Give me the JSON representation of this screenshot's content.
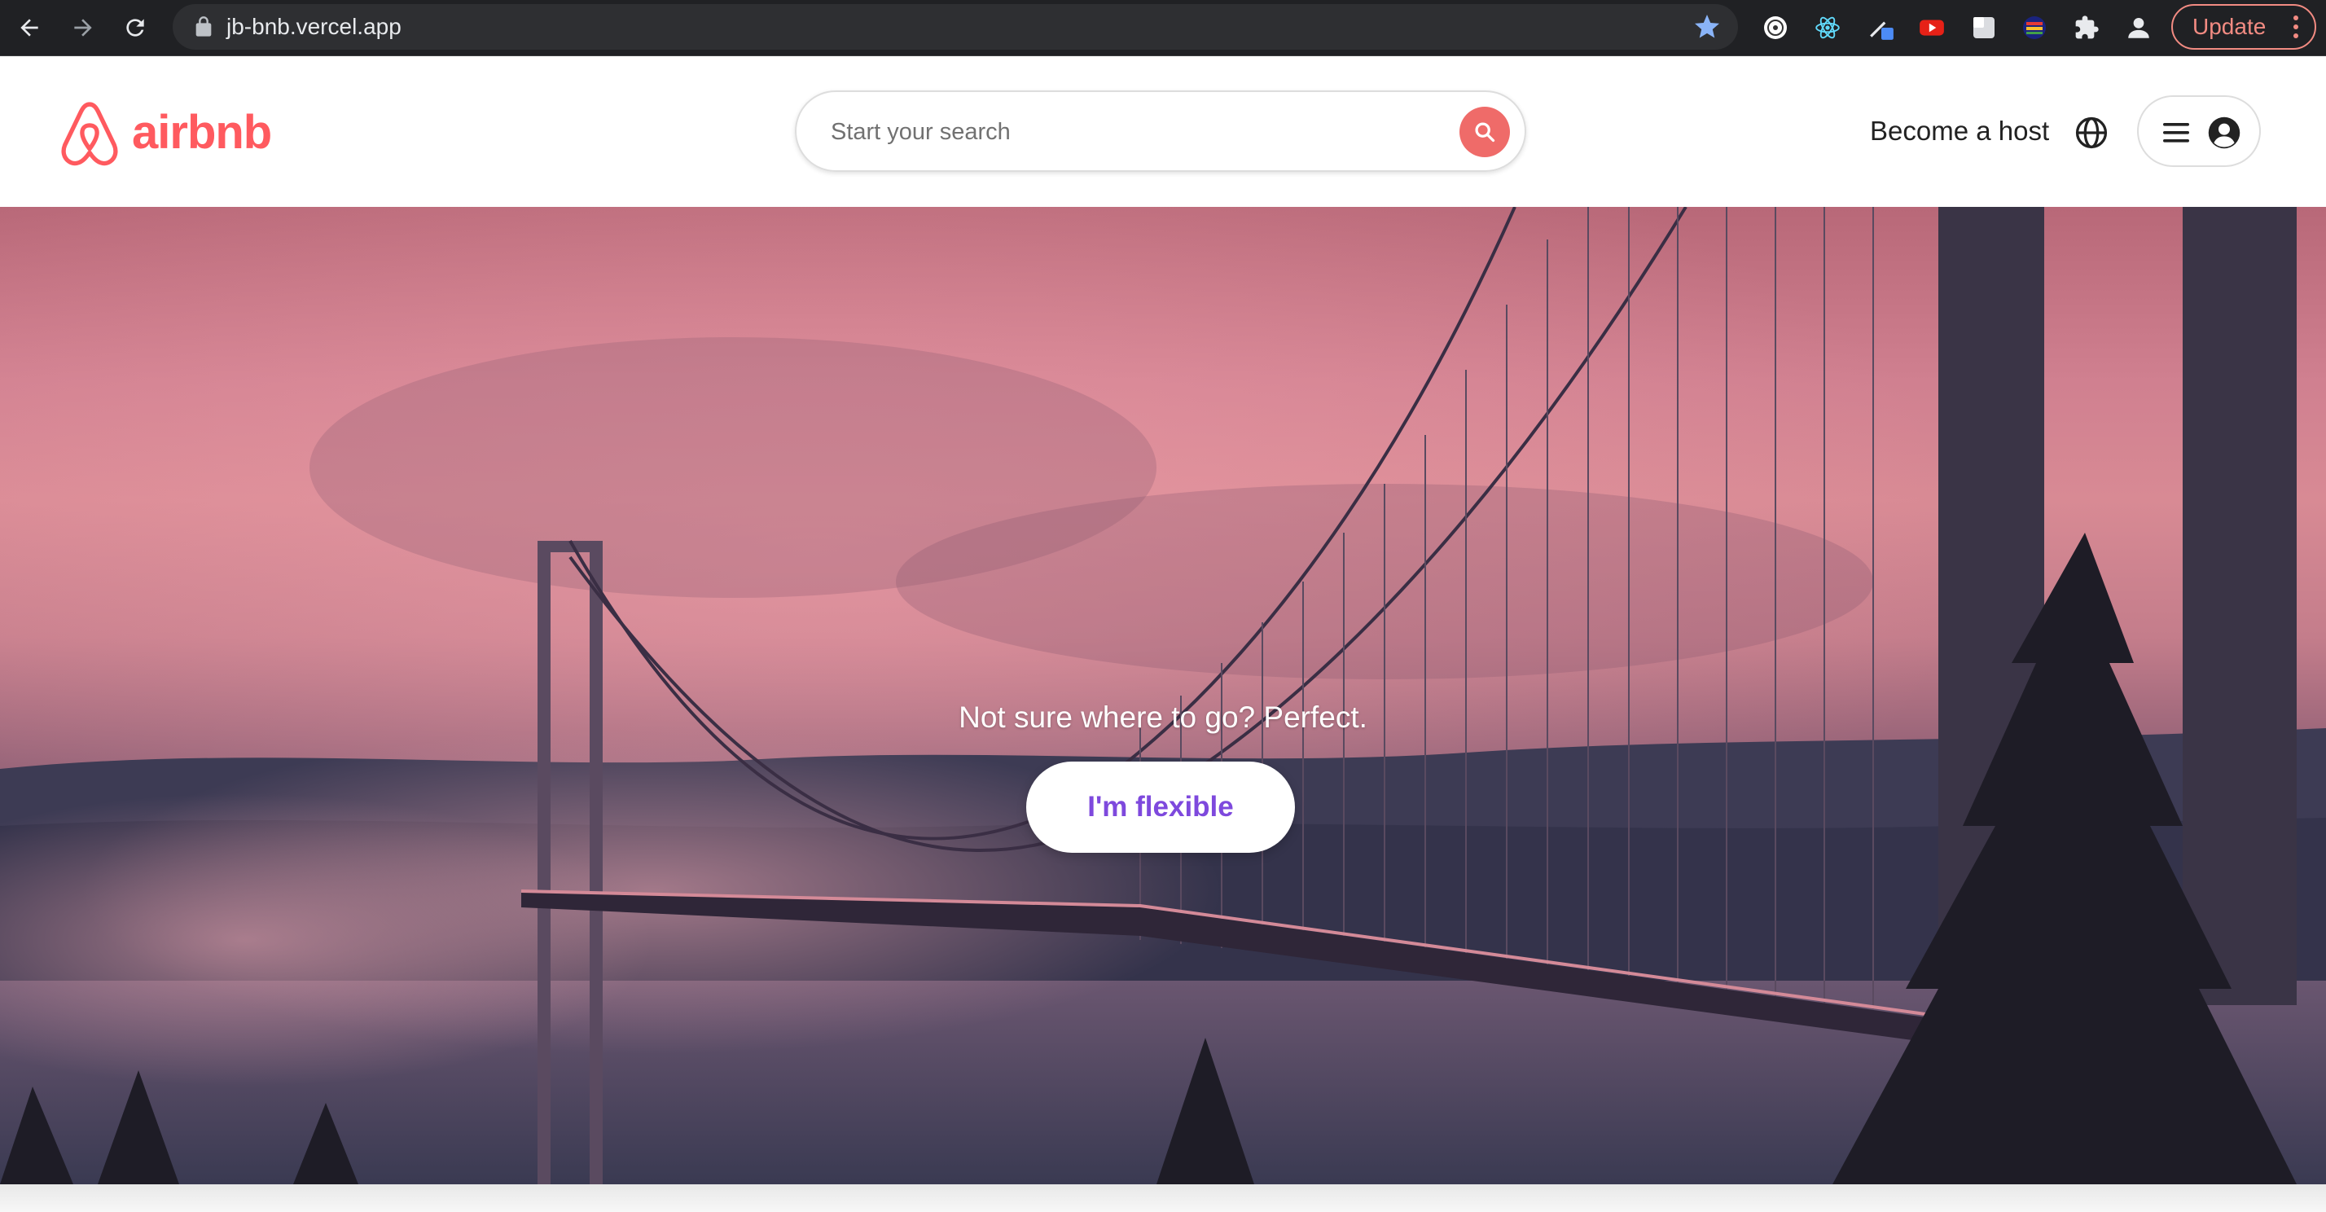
{
  "browser": {
    "url": "jb-bnb.vercel.app",
    "update_label": "Update",
    "icons": [
      "back-icon",
      "forward-icon",
      "reload-icon",
      "lock-icon",
      "bookmark-star-icon",
      "extension-icons",
      "puzzle-icon",
      "profile-icon",
      "kebab-menu-icon"
    ]
  },
  "header": {
    "logo_text": "airbnb",
    "search_placeholder": "Start your search",
    "become_host": "Become a host"
  },
  "hero": {
    "tagline": "Not sure where to go? Perfect.",
    "button_label": "I'm flexible"
  },
  "colors": {
    "brand": "#ff5a5f",
    "search_button": "#ef6b69",
    "flexible_text": "#7e49dd",
    "chrome_bg": "#202124"
  }
}
